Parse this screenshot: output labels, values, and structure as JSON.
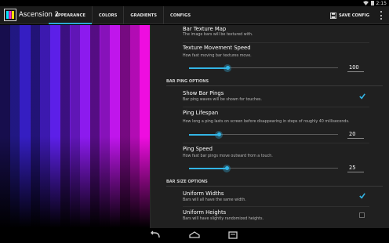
{
  "status_bar": {
    "time": "2:15",
    "icons": [
      "wifi-icon",
      "battery-icon"
    ]
  },
  "action_bar": {
    "app_title": "Ascension 2",
    "tabs": [
      {
        "label": "APPEARANCE",
        "active": true
      },
      {
        "label": "COLORS",
        "active": false
      },
      {
        "label": "GRADIENTS",
        "active": false
      },
      {
        "label": "CONFIGS",
        "active": false
      }
    ],
    "save_label": "SAVE CONFIG",
    "accent_color": "#2ea9d6"
  },
  "preview": {
    "bar_colors": [
      "#2a1a8c",
      "#2a1ea6",
      "#351ec2",
      "#3d22d6",
      "#4d20e0",
      "#5c1fe8",
      "#6c1ee8",
      "#7b1cea",
      "#8c1aee",
      "#9a18ee",
      "#ad17ee",
      "#c015ec",
      "#d612ea",
      "#e40fe6",
      "#ee0de0"
    ]
  },
  "settings": {
    "bar_texture_map": {
      "title": "Bar Texture Map",
      "summary": "The image bars will be textured with."
    },
    "texture_speed": {
      "title": "Texture Movement Speed",
      "summary": "How fast moving bar textures move.",
      "value": "100",
      "level": 0.2
    },
    "section_bar_ping": "BAR PING OPTIONS",
    "show_bar_pings": {
      "title": "Show Bar Pings",
      "summary": "Bar ping waves will be shown for touches.",
      "checked": true
    },
    "ping_lifespan": {
      "title": "Ping Lifespan",
      "summary": "How long a ping lasts on screen before disappearing in steps of roughly 40 milliseconds.",
      "value": "20",
      "level": 0.15
    },
    "ping_speed": {
      "title": "Ping Speed",
      "summary": "How fast bar pings move outward from a touch.",
      "value": "25",
      "level": 0.2
    },
    "section_bar_size": "BAR SIZE OPTIONS",
    "uniform_widths": {
      "title": "Uniform Widths",
      "summary": "Bars will all have the same width.",
      "checked": true
    },
    "uniform_heights": {
      "title": "Uniform Heights",
      "summary": "Bars will have slightly randomized heights.",
      "checked": false
    }
  },
  "nav_bar": {
    "buttons": [
      "back-icon",
      "home-icon",
      "recent-apps-icon"
    ]
  }
}
